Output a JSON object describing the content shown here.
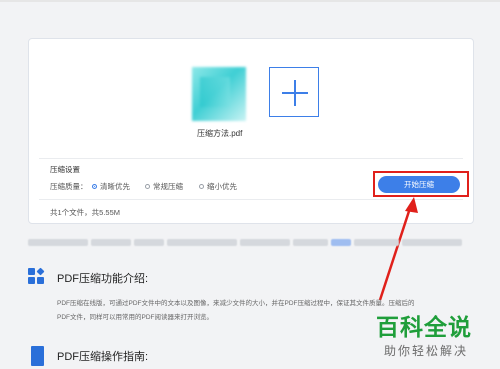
{
  "upload_card": {
    "file_name": "压缩方法.pdf",
    "settings_title": "压缩设置",
    "quality_label": "压缩质量：",
    "quality_options": [
      {
        "label": "清晰优先",
        "selected": true
      },
      {
        "label": "常规压缩",
        "selected": false
      },
      {
        "label": "缩小优先",
        "selected": false
      }
    ],
    "file_summary": "共1个文件，共5.55M",
    "start_button": "开始压缩",
    "accent_color": "#3d7fe8",
    "annotation_color": "#e0201b"
  },
  "intro": {
    "title": "PDF压缩功能介绍:",
    "line1": "PDF压缩在线版，可通过PDF文件中的文本以及图像，来减少文件的大小，并在PDF压缩过程中，保证其文件质量。压缩后的",
    "line2": "PDF文件，同样可以用常用的PDF阅读器来打开浏览。"
  },
  "guide": {
    "title": "PDF压缩操作指南:"
  },
  "watermark": {
    "main": "百科全说",
    "sub": "助你轻松解决"
  }
}
